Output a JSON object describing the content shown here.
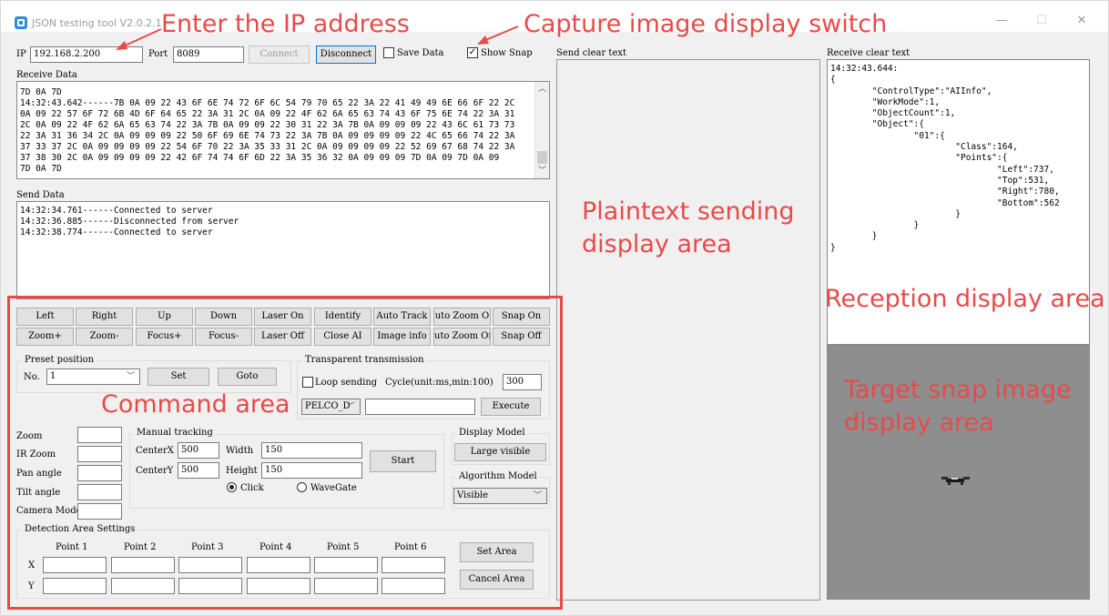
{
  "window": {
    "title": "JSON testing tool V2.0.2.1",
    "controls": {
      "minimize": "—",
      "maximize": "☐",
      "close": "✕"
    }
  },
  "connection": {
    "ip_label": "IP",
    "ip_value": "192.168.2.200",
    "port_label": "Port",
    "port_value": "8089",
    "connect_label": "Connect",
    "disconnect_label": "Disconnect",
    "save_data_label": "Save Data",
    "save_data_checked": false,
    "show_snap_label": "Show Snap",
    "show_snap_checked": true
  },
  "receive": {
    "label": "Receive Data",
    "lines": [
      "7D 0A 7D",
      "14:32:43.642------7B 0A 09 22 43 6F 6E 74 72 6F 6C 54 79 70 65 22 3A 22 41 49 49 6E 66 6F 22 2C",
      "0A 09 22 57 6F 72 6B 4D 6F 64 65 22 3A 31 2C 0A 09 22 4F 62 6A 65 63 74 43 6F 75 6E 74 22 3A 31",
      "2C 0A 09 22 4F 62 6A 65 63 74 22 3A 7B 0A 09 09 22 30 31 22 3A 7B 0A 09 09 09 22 43 6C 61 73 73",
      "22 3A 31 36 34 2C 0A 09 09 09 22 50 6F 69 6E 74 73 22 3A 7B 0A 09 09 09 09 22 4C 65 66 74 22 3A",
      "37 33 37 2C 0A 09 09 09 09 22 54 6F 70 22 3A 35 33 31 2C 0A 09 09 09 09 22 52 69 67 68 74 22 3A",
      "37 38 30 2C 0A 09 09 09 09 22 42 6F 74 74 6F 6D 22 3A 35 36 32 0A 09 09 09 7D 0A 09 7D 0A 09",
      "7D 0A 7D"
    ]
  },
  "send": {
    "label": "Send Data",
    "lines": [
      "14:32:34.761------Connected to server",
      "14:32:36.885------Disconnected from server",
      "14:32:38.774------Connected to server"
    ]
  },
  "commands": {
    "row1": [
      "Left",
      "Right",
      "Up",
      "Down",
      "Laser On",
      "Identify",
      "Auto Track",
      "uto Zoom O",
      "Snap On"
    ],
    "row2": [
      "Zoom+",
      "Zoom-",
      "Focus+",
      "Focus-",
      "Laser Off",
      "Close AI",
      "Image info",
      "uto Zoom Of",
      "Snap Off"
    ]
  },
  "preset": {
    "group_label": "Preset position",
    "no_label": "No.",
    "no_value": "1",
    "set_label": "Set",
    "goto_label": "Goto"
  },
  "transparent": {
    "group_label": "Transparent transmission",
    "loop_label": "Loop sending",
    "loop_checked": false,
    "cycle_label": "Cycle(unit:ms,min:100)",
    "cycle_value": "300",
    "protocol_value": "PELCO_D",
    "command_value": "",
    "execute_label": "Execute"
  },
  "status_fields": {
    "zoom_label": "Zoom",
    "ir_zoom_label": "IR Zoom",
    "pan_label": "Pan angle",
    "tilt_label": "Tilt angle",
    "camera_mode_label": "Camera Mode"
  },
  "manual_tracking": {
    "group_label": "Manual tracking",
    "centerx_label": "CenterX",
    "centerx_value": "500",
    "centery_label": "CenterY",
    "centery_value": "500",
    "width_label": "Width",
    "width_value": "150",
    "height_label": "Height",
    "height_value": "150",
    "start_label": "Start",
    "click_label": "Click",
    "wavegate_label": "WaveGate",
    "selected": "Click"
  },
  "display_model": {
    "group_label": "Display Model",
    "button_label": "Large visible"
  },
  "algorithm_model": {
    "group_label": "Algorithm Model",
    "value": "Visible"
  },
  "detection": {
    "group_label": "Detection Area Settings",
    "points": [
      "Point 1",
      "Point 2",
      "Point 3",
      "Point 4",
      "Point 5",
      "Point 6"
    ],
    "x_label": "X",
    "y_label": "Y",
    "set_area_label": "Set Area",
    "cancel_area_label": "Cancel Area"
  },
  "send_clear": {
    "label": "Send clear text"
  },
  "receive_clear": {
    "label": "Receive clear text",
    "lines": [
      "14:32:43.644:",
      "{",
      "        \"ControlType\":\"AIInfo\",",
      "        \"WorkMode\":1,",
      "        \"ObjectCount\":1,",
      "        \"Object\":{",
      "                \"01\":{",
      "                        \"Class\":164,",
      "                        \"Points\":{",
      "                                \"Left\":737,",
      "                                \"Top\":531,",
      "                                \"Right\":780,",
      "                                \"Bottom\":562",
      "                        }",
      "                }",
      "        }",
      "}"
    ]
  },
  "annotations": {
    "ip": "Enter the IP address",
    "snap_switch": "Capture image display switch",
    "plaintext": [
      "Plaintext sending",
      "display area"
    ],
    "reception": "Reception display area",
    "command": "Command area",
    "snap_area": [
      "Target snap image",
      "display area"
    ]
  },
  "colors": {
    "annotation": "#e84a4a",
    "window_bg": "#f0f0f0",
    "snap_bg": "#8e8e8e"
  }
}
